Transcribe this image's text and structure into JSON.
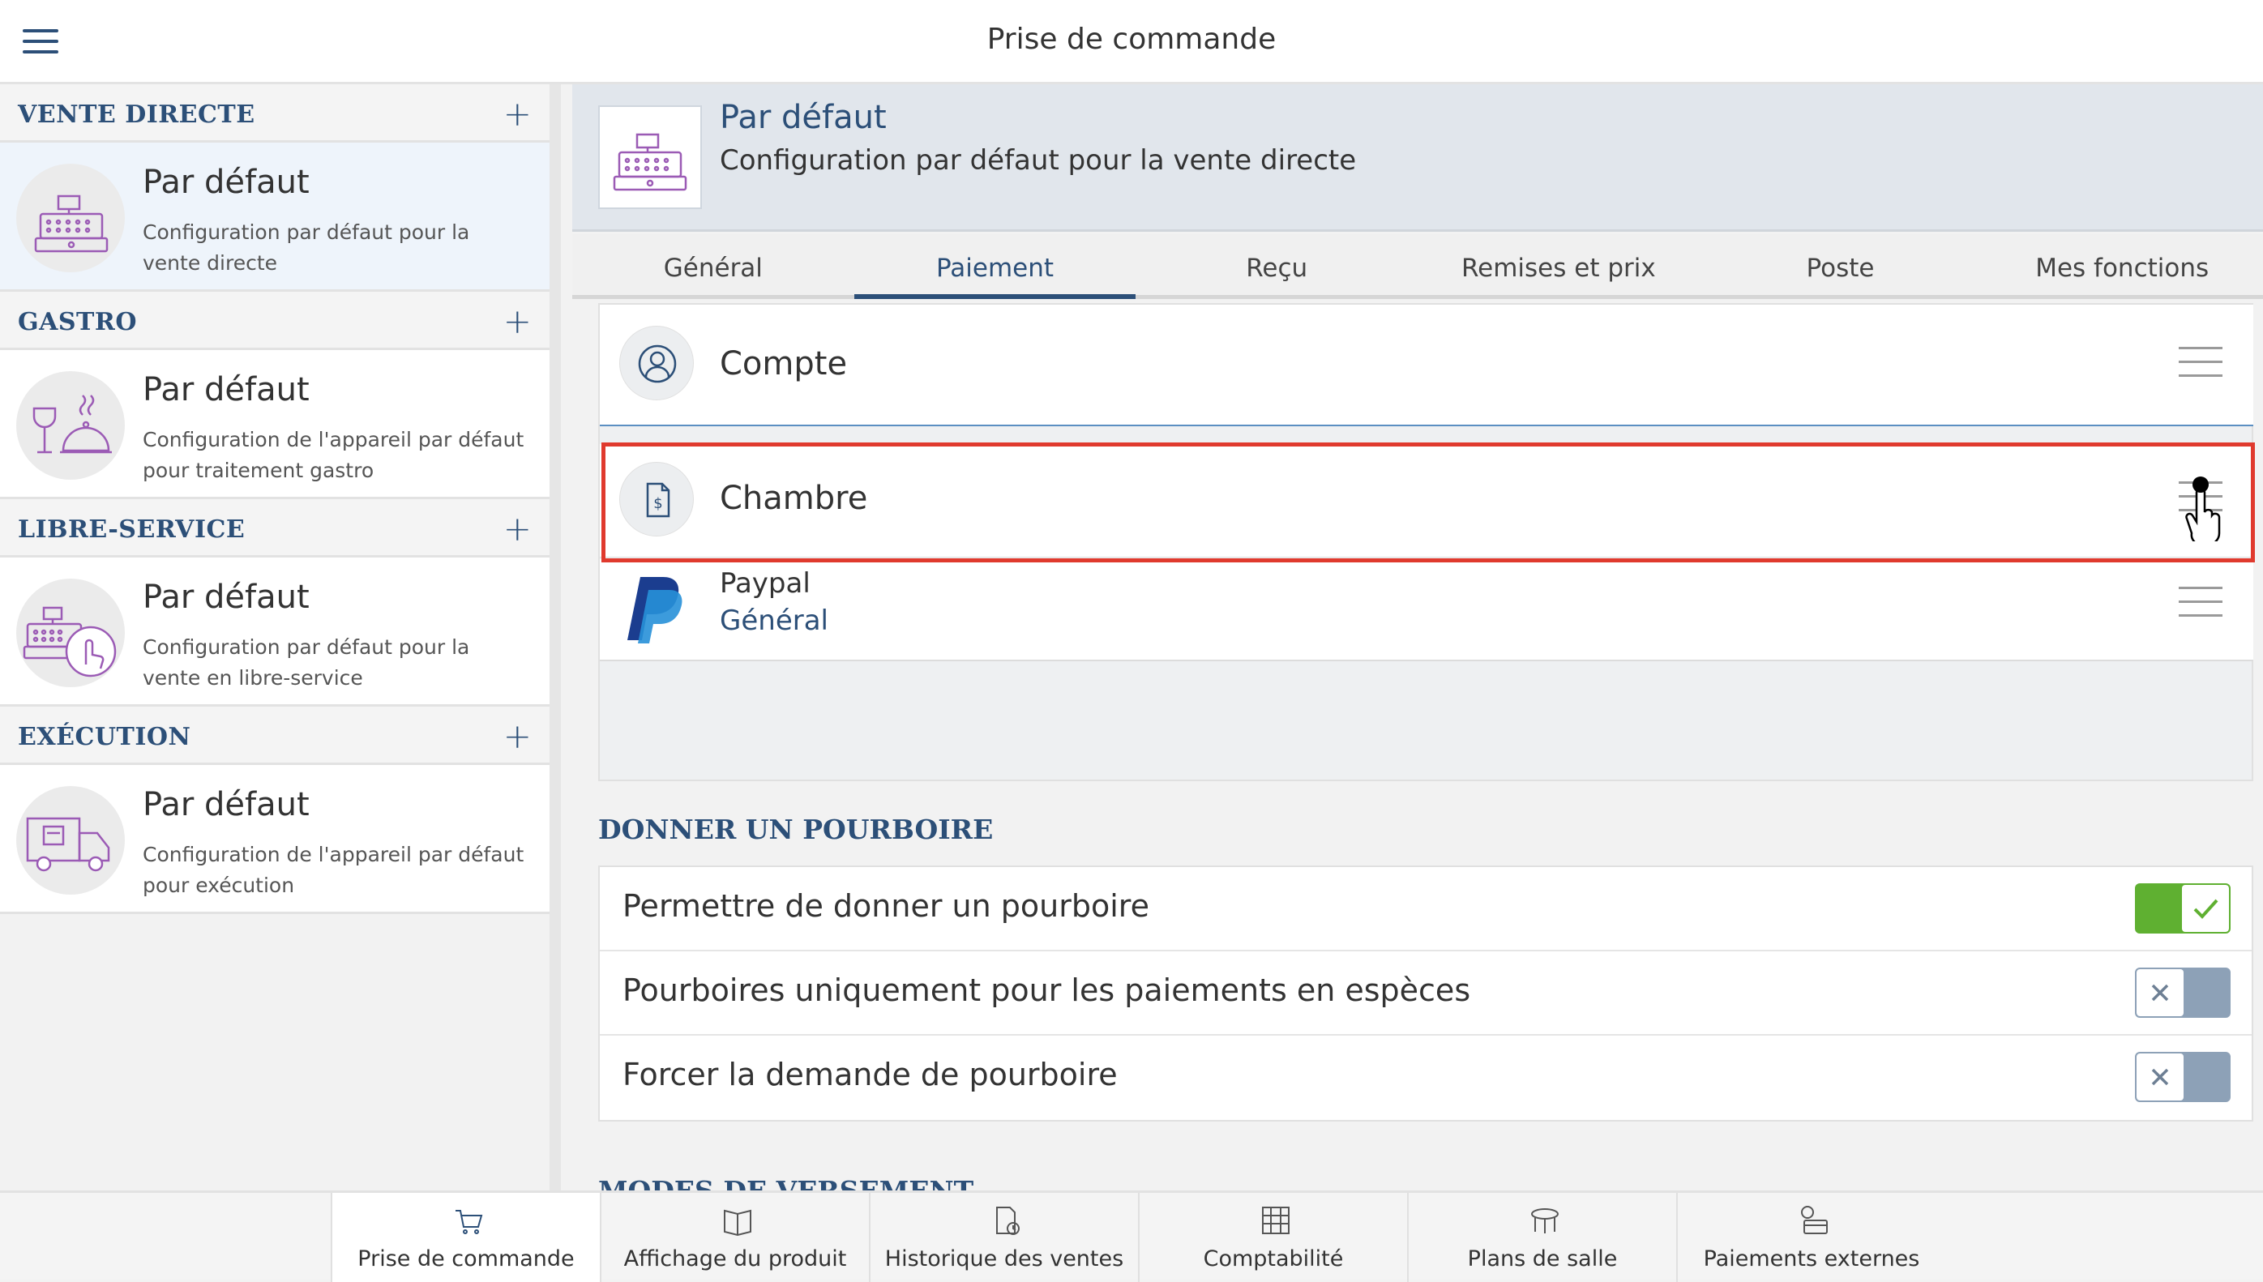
{
  "app": {
    "title": "Prise de commande"
  },
  "sidebar": {
    "sections": [
      {
        "label": "VENTE DIRECTE",
        "item": {
          "title": "Par défaut",
          "desc": "Configuration par défaut pour la vente directe"
        }
      },
      {
        "label": "GASTRO",
        "item": {
          "title": "Par défaut",
          "desc": "Configuration de l'appareil par défaut pour traitement gastro"
        }
      },
      {
        "label": "LIBRE-SERVICE",
        "item": {
          "title": "Par défaut",
          "desc": "Configuration par défaut pour la vente en libre-service"
        }
      },
      {
        "label": "EXÉCUTION",
        "item": {
          "title": "Par défaut",
          "desc": "Configuration de l'appareil par défaut pour exécution"
        }
      }
    ],
    "add_symbol": "+"
  },
  "main": {
    "title": "Par défaut",
    "subtitle": "Configuration par défaut pour la vente directe",
    "tabs": [
      "Général",
      "Paiement",
      "Reçu",
      "Remises et prix",
      "Poste",
      "Mes fonctions"
    ],
    "active_tab": "Paiement"
  },
  "payments": [
    {
      "name": "Compte",
      "icon": "user-icon"
    },
    {
      "name": "Chambre",
      "icon": "receipt-dollar-icon"
    },
    {
      "name": "Paypal",
      "sub": "Général",
      "icon": "paypal-logo"
    }
  ],
  "tips": {
    "title": "DONNER UN POURBOIRE",
    "rows": [
      {
        "label": "Permettre de donner un pourboire",
        "enabled": true
      },
      {
        "label": "Pourboires uniquement pour les paiements en espèces",
        "enabled": false
      },
      {
        "label": "Forcer la demande de pourboire",
        "enabled": false
      }
    ]
  },
  "partial_section": "MODES DE VERSEMENT",
  "bottom_nav": [
    {
      "label": "Prise de commande",
      "icon": "cart-icon",
      "active": true
    },
    {
      "label": "Affichage du produit",
      "icon": "book-icon"
    },
    {
      "label": "Historique des ventes",
      "icon": "history-icon"
    },
    {
      "label": "Comptabilité",
      "icon": "ledger-icon"
    },
    {
      "label": "Plans de salle",
      "icon": "table-icon"
    },
    {
      "label": "Paiements externes",
      "icon": "external-payment-icon"
    }
  ],
  "colors": {
    "accent": "#2c4f78",
    "toggle_on": "#5fb031",
    "toggle_off": "#8da1b7",
    "highlight": "#e03a2e"
  }
}
